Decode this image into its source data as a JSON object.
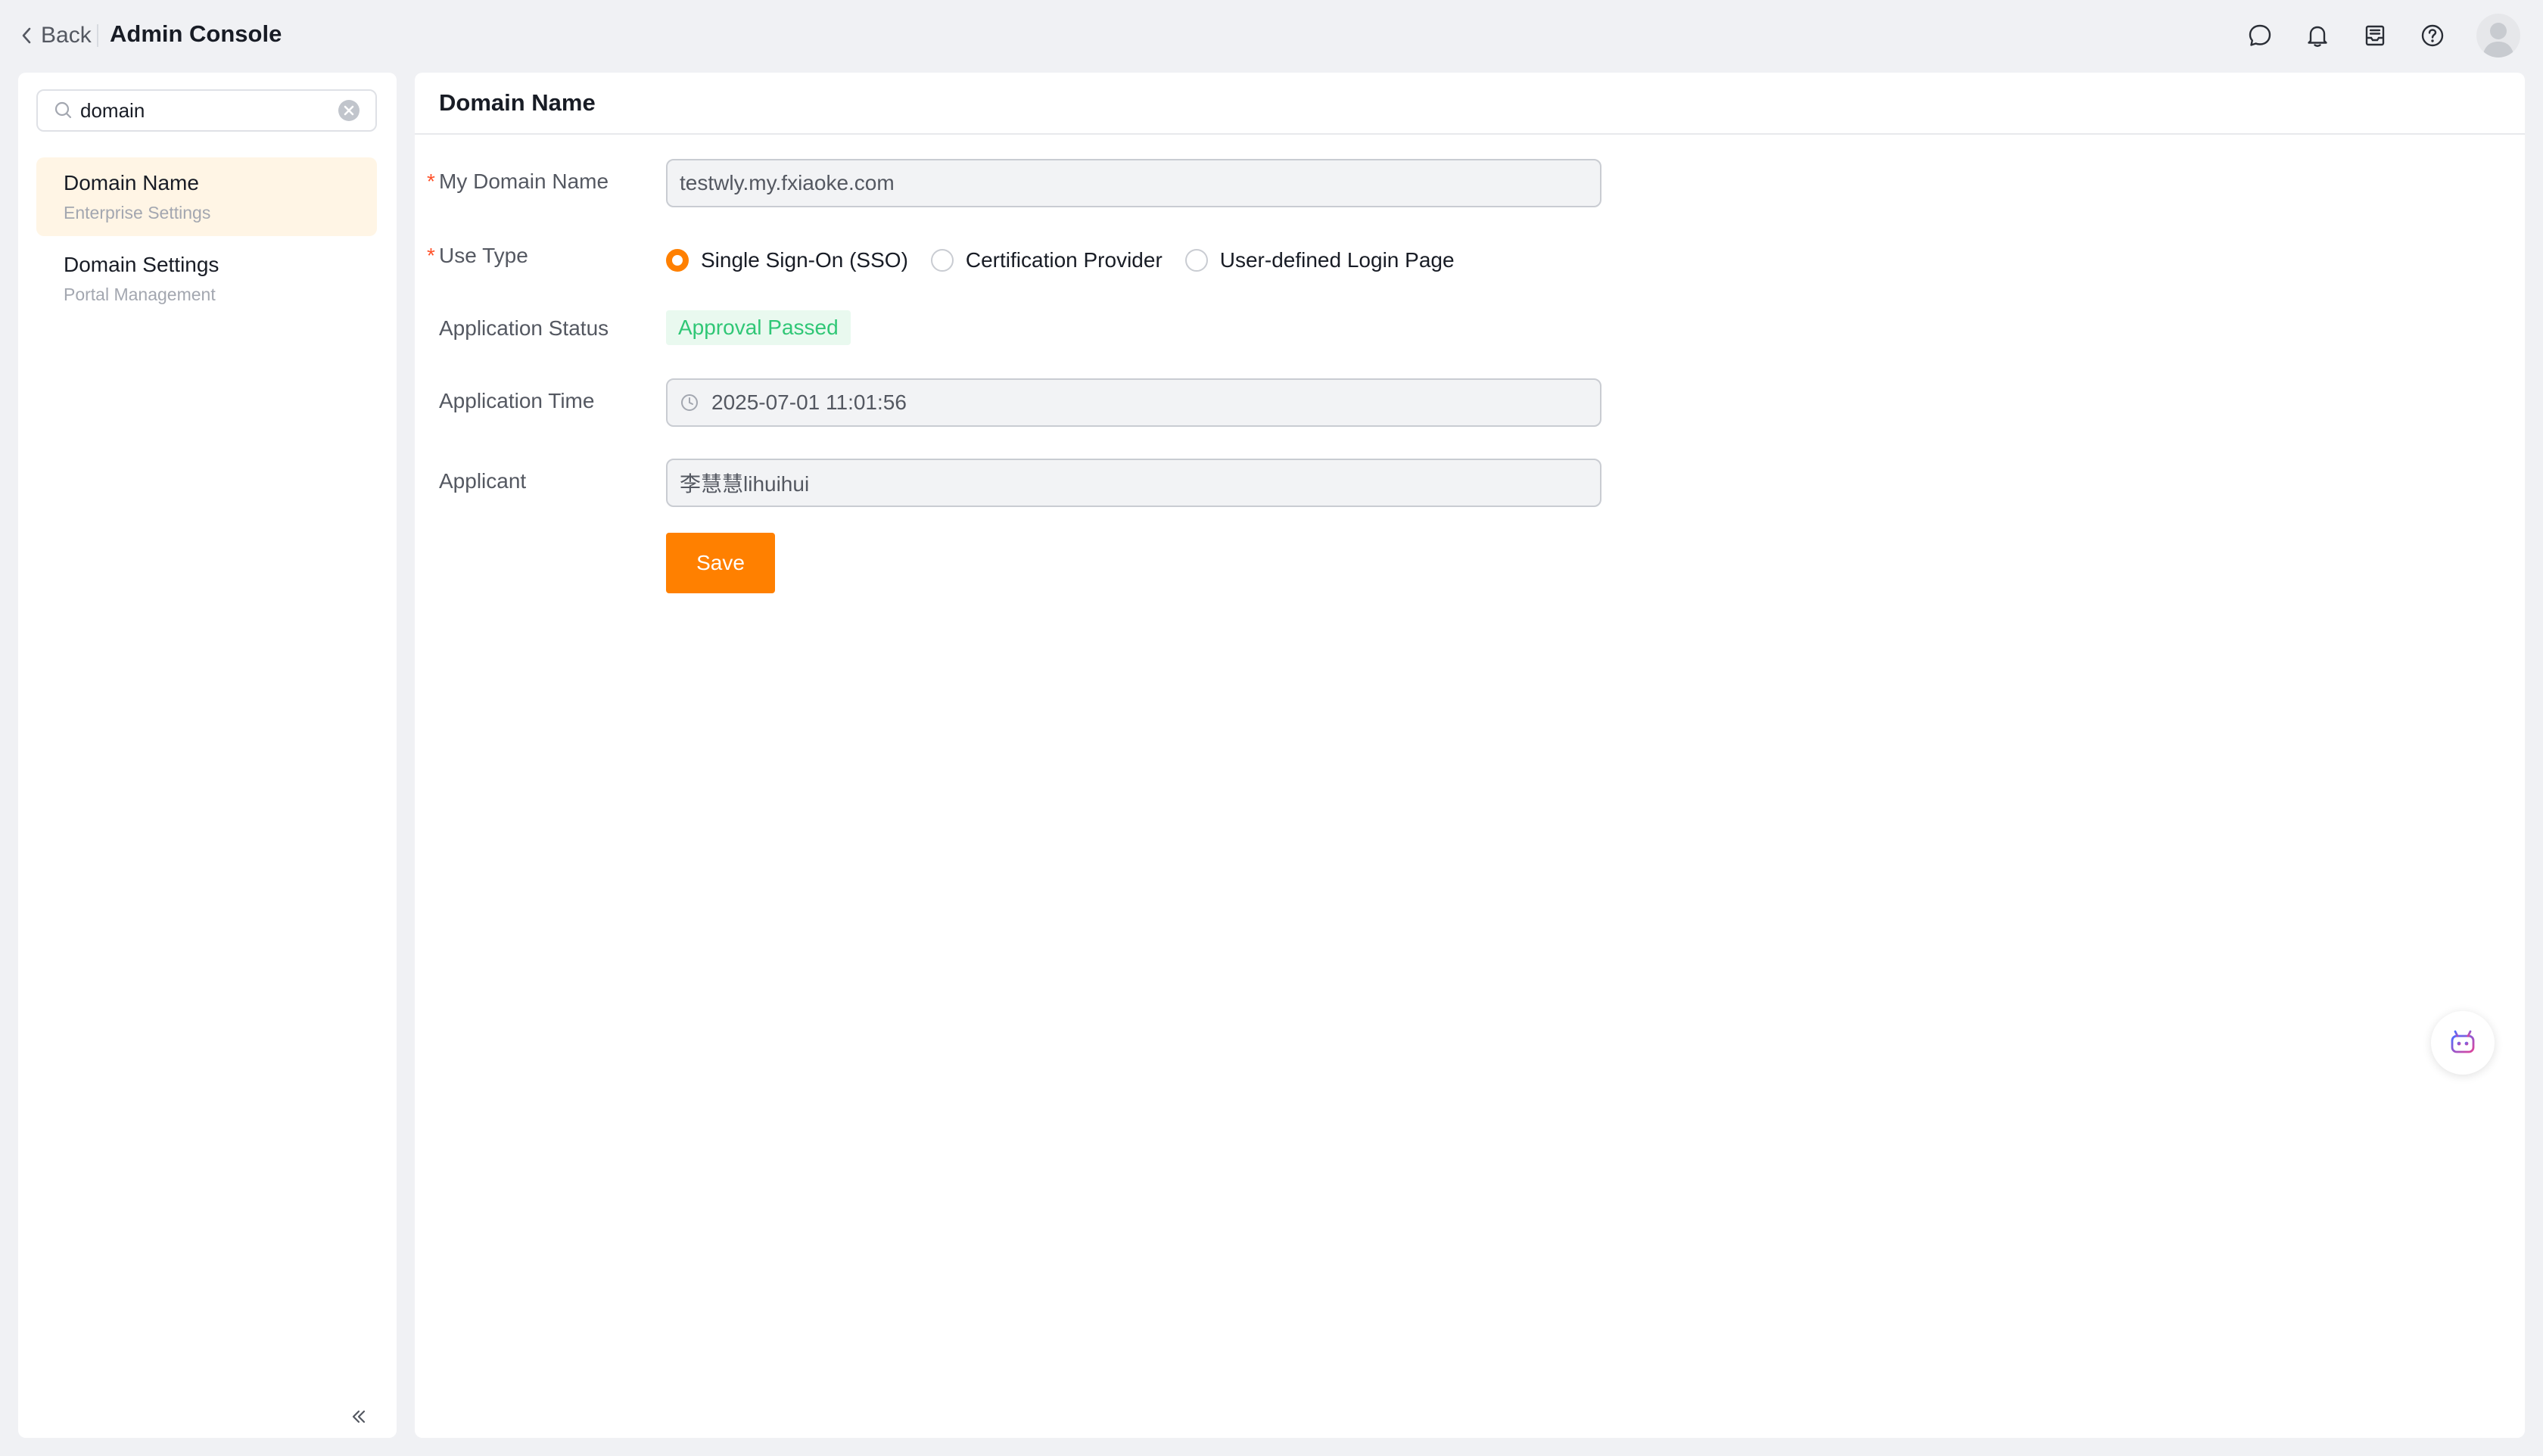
{
  "topbar": {
    "back_label": "Back",
    "title": "Admin Console",
    "icons": [
      "chat-icon",
      "bell-icon",
      "inbox-icon",
      "help-icon",
      "avatar"
    ]
  },
  "sidebar": {
    "search": {
      "value": "domain"
    },
    "items": [
      {
        "title": "Domain Name",
        "subtitle": "Enterprise Settings",
        "active": true
      },
      {
        "title": "Domain Settings",
        "subtitle": "Portal Management",
        "active": false
      }
    ]
  },
  "main": {
    "title": "Domain Name",
    "form": {
      "domain": {
        "label": "My Domain Name",
        "required": true,
        "value": "testwly.my.fxiaoke.com"
      },
      "use_type": {
        "label": "Use Type",
        "required": true,
        "options": [
          "Single Sign-On (SSO)",
          "Certification Provider",
          "User-defined Login Page"
        ],
        "selected": "Single Sign-On (SSO)"
      },
      "status": {
        "label": "Application Status",
        "value": "Approval Passed"
      },
      "time": {
        "label": "Application Time",
        "value": "2025-07-01 11:01:56"
      },
      "applicant": {
        "label": "Applicant",
        "value": "李慧慧lihuihui"
      },
      "save_label": "Save"
    }
  },
  "colors": {
    "accent": "#ff8000",
    "active_bg": "#fff5e5",
    "success": "#30c776",
    "required": "#ff522a"
  }
}
